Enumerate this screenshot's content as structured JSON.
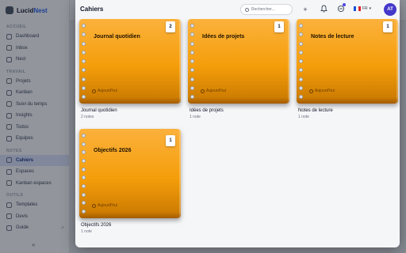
{
  "app": {
    "brand_prefix": "Lucid",
    "brand_suffix": "Nest"
  },
  "sidebar": {
    "sections": [
      {
        "title": "ACCUEIL",
        "items": [
          "Dashboard",
          "Inbox",
          "Nest"
        ]
      },
      {
        "title": "TRAVAIL",
        "items": [
          "Projets",
          "Kanban",
          "Suivi du temps",
          "Insights",
          "Todos",
          "Equipes"
        ]
      },
      {
        "title": "NOTES",
        "items": [
          "Cahiers",
          "Espaces",
          "Kanban espaces"
        ]
      },
      {
        "title": "OUTILS",
        "items": [
          "Templates",
          "Devis",
          "Guide"
        ]
      }
    ],
    "active_item": "Cahiers",
    "collapse_glyph": "«"
  },
  "modal": {
    "title": "Cahiers",
    "search_placeholder": "Rechercher...",
    "add_glyph": "+",
    "lang_label": "FR",
    "avatar_initials": "AT"
  },
  "notebooks": [
    {
      "title": "Journal quotidien",
      "badge": "2",
      "date": "Aujourd'hui",
      "name": "Journal quotidien",
      "count": "2 notes"
    },
    {
      "title": "Idées de projets",
      "badge": "1",
      "date": "Aujourd'hui",
      "name": "Idées de projets",
      "count": "1 note"
    },
    {
      "title": "Notes de lecture",
      "badge": "1",
      "date": "Aujourd'hui",
      "name": "Notes de lecture",
      "count": "1 note"
    },
    {
      "title": "Objectifs 2026",
      "badge": "1",
      "date": "Aujourd'hui",
      "name": "Objectifs 2026",
      "count": "1 note"
    }
  ],
  "colors": {
    "notebook": "#f59e0b",
    "accent": "#4338ca",
    "overlay": "#111827"
  }
}
